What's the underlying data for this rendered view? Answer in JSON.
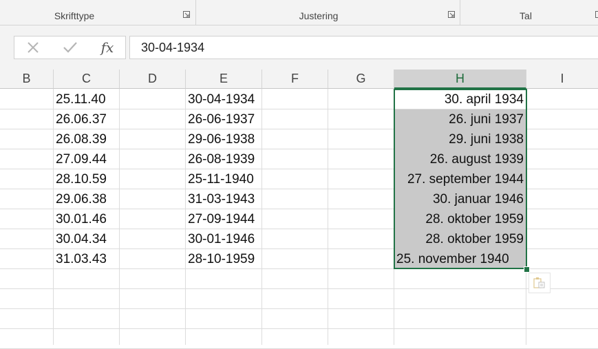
{
  "ribbon": {
    "groups": [
      {
        "label": "Skrifttype"
      },
      {
        "label": "Justering"
      },
      {
        "label": "Tal"
      }
    ]
  },
  "formula_bar": {
    "cancel_icon": "close-icon",
    "enter_icon": "check-icon",
    "fx_label": "fx",
    "value": "30-04-1934"
  },
  "columns": [
    "B",
    "C",
    "D",
    "E",
    "F",
    "G",
    "H",
    "I"
  ],
  "selected_column": "H",
  "column_c": [
    "25.11.40",
    "26.06.37",
    "26.08.39",
    "27.09.44",
    "28.10.59",
    "29.06.38",
    "30.01.46",
    "30.04.34",
    "31.03.43"
  ],
  "column_e": [
    "30-04-1934",
    "26-06-1937",
    "29-06-1938",
    "26-08-1939",
    "25-11-1940",
    "31-03-1943",
    "27-09-1944",
    "30-01-1946",
    "28-10-1959"
  ],
  "column_h": [
    "30. april 1934",
    "26. juni 1937",
    "29. juni 1938",
    "26. august 1939",
    "27. september 1944",
    "30. januar 1946",
    "28. oktober 1959",
    "28. oktober 1959",
    "25. november 1940"
  ],
  "colors": {
    "selection_border": "#217346",
    "selection_fill": "#c9c9c9",
    "header_bg": "#f3f3f3"
  },
  "paste_options_icon": "paste-options-icon"
}
